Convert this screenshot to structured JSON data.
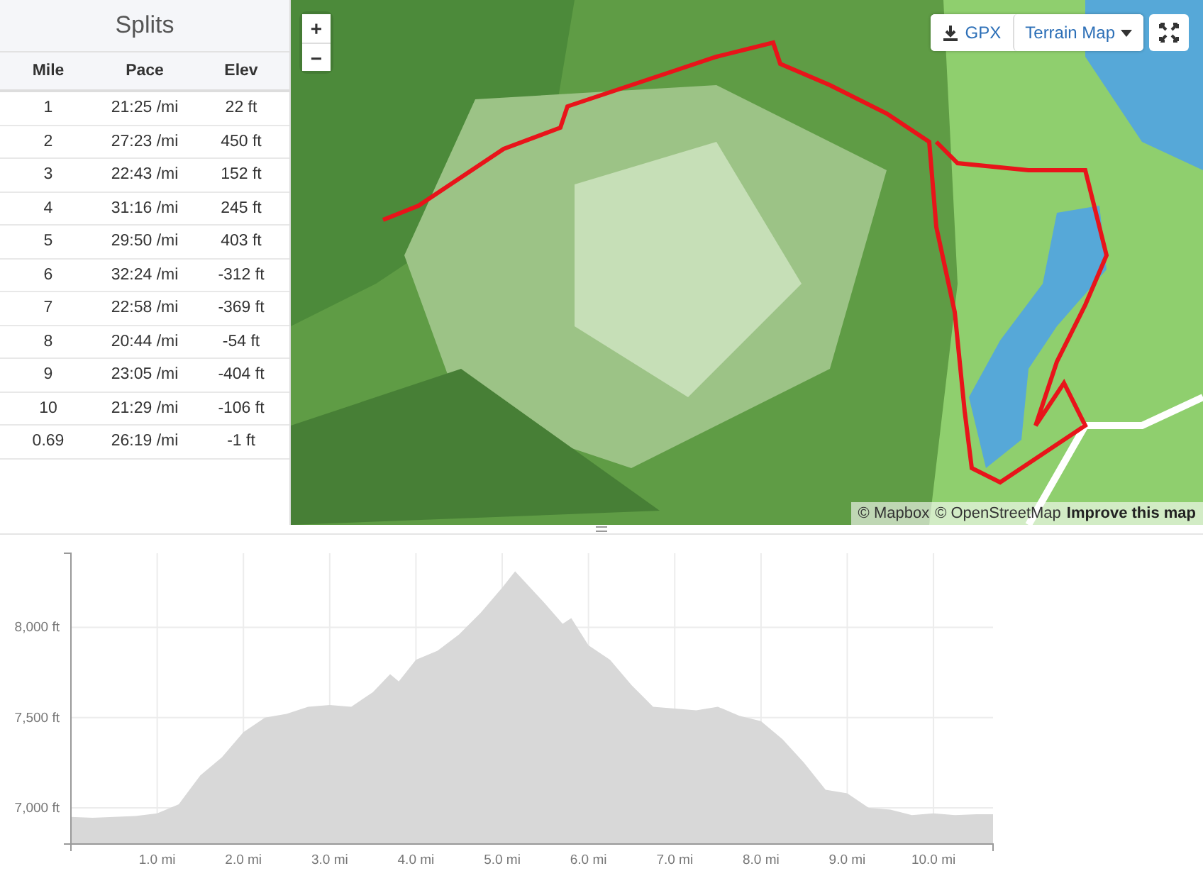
{
  "splits": {
    "title": "Splits",
    "columns": [
      "Mile",
      "Pace",
      "Elev"
    ],
    "rows": [
      [
        "1",
        "21:25 /mi",
        "22 ft"
      ],
      [
        "2",
        "27:23 /mi",
        "450 ft"
      ],
      [
        "3",
        "22:43 /mi",
        "152 ft"
      ],
      [
        "4",
        "31:16 /mi",
        "245 ft"
      ],
      [
        "5",
        "29:50 /mi",
        "403 ft"
      ],
      [
        "6",
        "32:24 /mi",
        "-312 ft"
      ],
      [
        "7",
        "22:58 /mi",
        "-369 ft"
      ],
      [
        "8",
        "20:44 /mi",
        "-54 ft"
      ],
      [
        "9",
        "23:05 /mi",
        "-404 ft"
      ],
      [
        "10",
        "21:29 /mi",
        "-106 ft"
      ],
      [
        "0.69",
        "26:19 /mi",
        "-1 ft"
      ]
    ]
  },
  "map": {
    "kind": "picture",
    "zoom_in": "+",
    "zoom_out": "−",
    "gpx_button": "GPX",
    "map_type": "Terrain Map",
    "attribution": [
      "© Mapbox",
      "© OpenStreetMap"
    ],
    "improve_link": "Improve this map"
  },
  "elevation": {
    "chart_data": {
      "type": "area",
      "xlim": [
        0,
        10.69
      ],
      "ylim": [
        6800,
        8410
      ],
      "x": [
        0,
        0.25,
        0.5,
        0.75,
        1.0,
        1.25,
        1.5,
        1.75,
        2.0,
        2.25,
        2.5,
        2.75,
        3.0,
        3.25,
        3.5,
        3.7,
        3.8,
        4.0,
        4.25,
        4.5,
        4.75,
        5.0,
        5.15,
        5.5,
        5.7,
        5.8,
        6.0,
        6.25,
        6.5,
        6.75,
        7.0,
        7.25,
        7.5,
        7.75,
        8.0,
        8.25,
        8.5,
        8.75,
        9.0,
        9.25,
        9.5,
        9.75,
        10.0,
        10.25,
        10.5,
        10.69
      ],
      "grid": true,
      "series": [
        {
          "color": "#d8d8d8",
          "values": [
            6950,
            6945,
            6950,
            6955,
            6970,
            7020,
            7180,
            7280,
            7420,
            7500,
            7520,
            7560,
            7570,
            7560,
            7640,
            7740,
            7700,
            7820,
            7870,
            7960,
            8080,
            8220,
            8310,
            8130,
            8020,
            8050,
            7900,
            7820,
            7680,
            7560,
            7550,
            7540,
            7560,
            7510,
            7480,
            7380,
            7250,
            7100,
            7080,
            7000,
            6990,
            6960,
            6970,
            6960,
            6965,
            6965
          ]
        }
      ],
      "xticks": [
        {
          "value": 1,
          "label": "1.0 mi"
        },
        {
          "value": 2,
          "label": "2.0 mi"
        },
        {
          "value": 3,
          "label": "3.0 mi"
        },
        {
          "value": 4,
          "label": "4.0 mi"
        },
        {
          "value": 5,
          "label": "5.0 mi"
        },
        {
          "value": 6,
          "label": "6.0 mi"
        },
        {
          "value": 7,
          "label": "7.0 mi"
        },
        {
          "value": 8,
          "label": "8.0 mi"
        },
        {
          "value": 9,
          "label": "9.0 mi"
        },
        {
          "value": 10,
          "label": "10.0 mi"
        }
      ],
      "yticks": [
        {
          "value": 7000,
          "label": "7,000 ft"
        },
        {
          "value": 7500,
          "label": "7,500 ft"
        },
        {
          "value": 8000,
          "label": "8,000 ft"
        }
      ]
    }
  }
}
